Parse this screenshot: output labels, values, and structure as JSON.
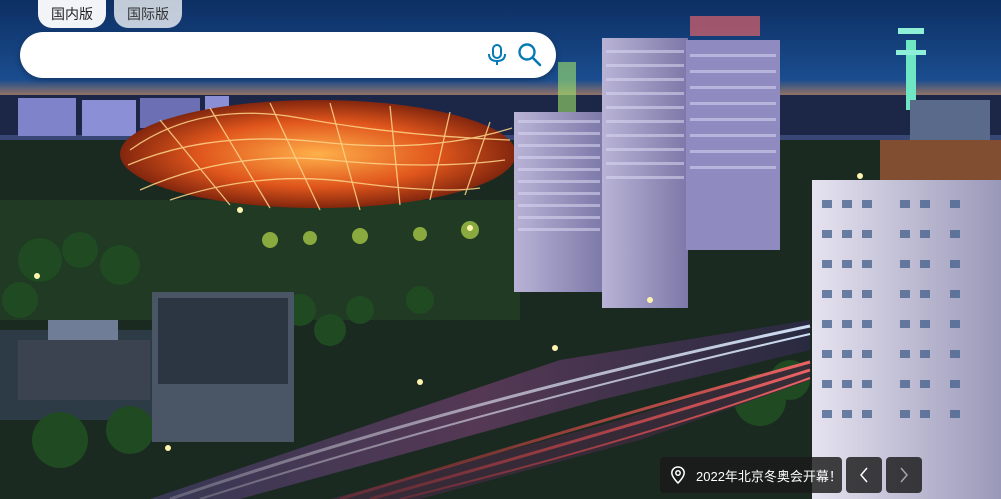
{
  "tabs": [
    {
      "label": "国内版",
      "active": true
    },
    {
      "label": "国际版",
      "active": false
    }
  ],
  "search": {
    "value": "",
    "placeholder": "",
    "icon_color": "#067ab4"
  },
  "background": {
    "description_icon": "city-night-photo"
  },
  "caption": {
    "text": "2022年北京冬奥会开幕！",
    "icon": "location-pin-icon"
  },
  "carousel": {
    "prev_icon": "chevron-left-icon",
    "next_icon": "chevron-right-icon"
  }
}
